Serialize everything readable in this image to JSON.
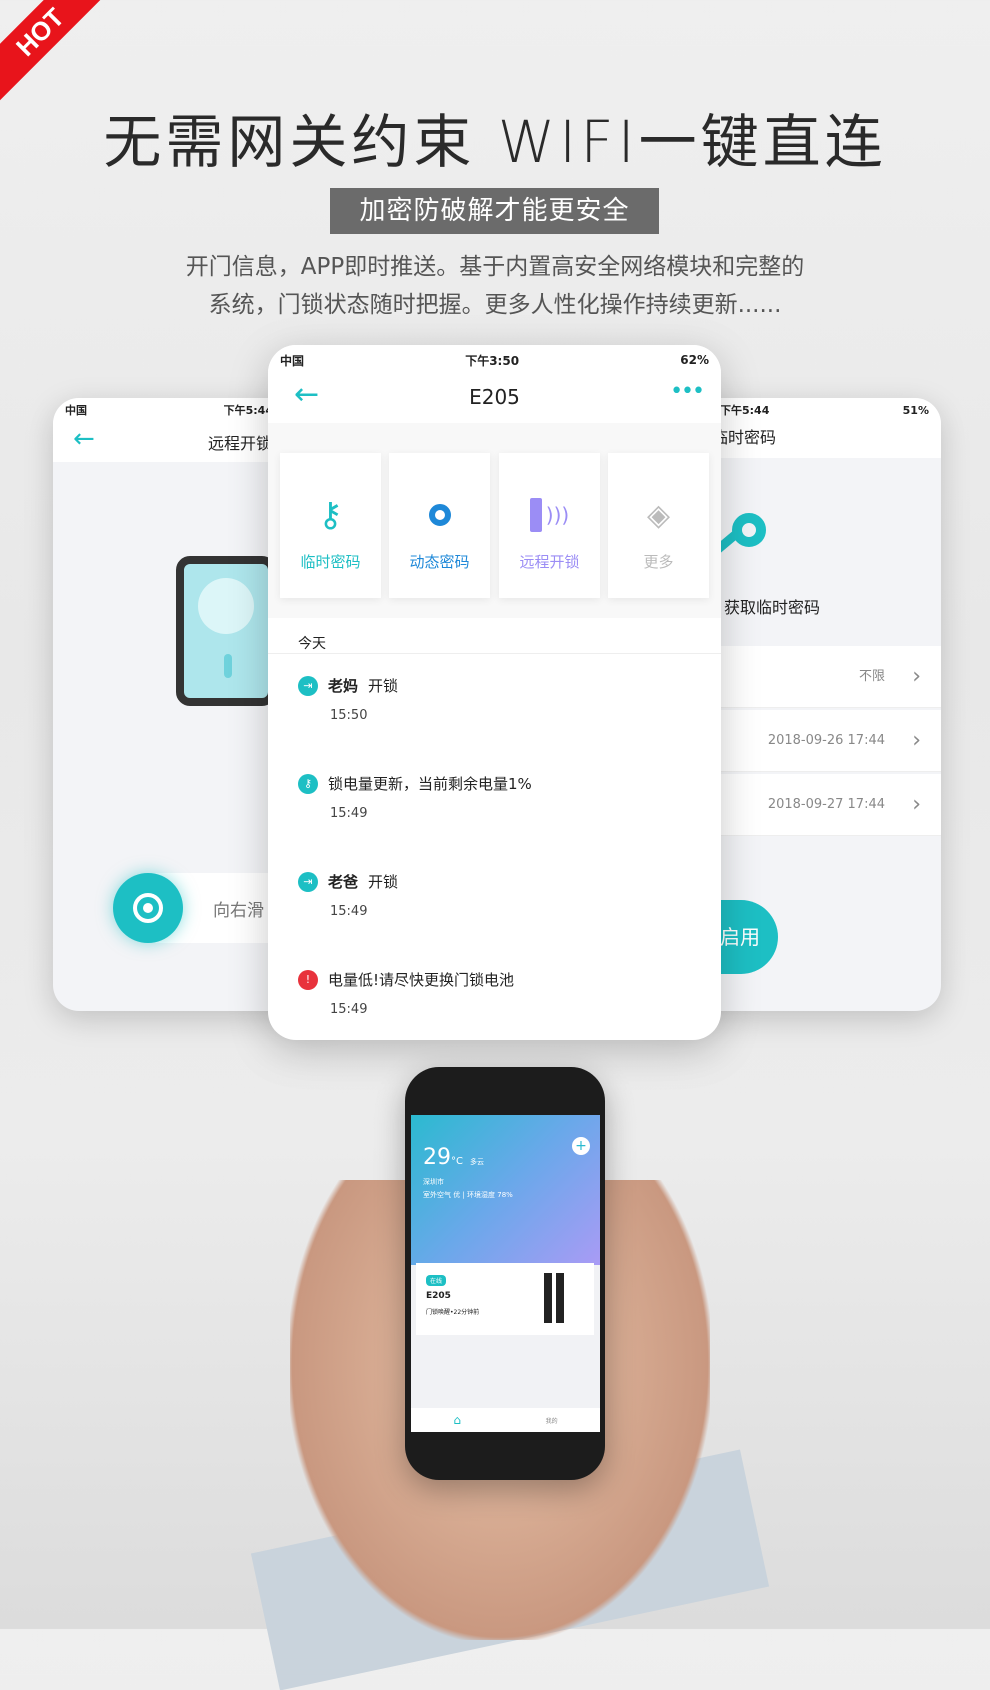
{
  "badge": "HOT",
  "headline": "无需网关约束 WIFI一键直连",
  "subheadline": "加密防破解才能更安全",
  "description": [
    "开门信息，APP即时推送。基于内置高安全网络模块和完整的",
    "系统，门锁状态随时把握。更多人性化操作持续更新......"
  ],
  "left_screen": {
    "carrier": "中国",
    "time": "下午5:44",
    "title": "远程开锁",
    "slide_hint": "向右滑"
  },
  "center_screen": {
    "carrier": "中国",
    "time": "下午3:50",
    "battery": "62%",
    "title": "E205",
    "tiles": [
      {
        "label": "临时密码",
        "color": "#1dbfc4",
        "icon": "key-icon"
      },
      {
        "label": "动态密码",
        "color": "#1e88d8",
        "icon": "dynamic-key-icon"
      },
      {
        "label": "远程开锁",
        "color": "#9b8df5",
        "icon": "remote-unlock-icon"
      },
      {
        "label": "更多",
        "color": "#bbbbbb",
        "icon": "layers-icon"
      }
    ],
    "section": "今天",
    "events": [
      {
        "who": "老妈",
        "action": "开锁",
        "time": "15:50",
        "type": "unlock"
      },
      {
        "who": "",
        "action": "锁电量更新，当前剩余电量1%",
        "time": "15:49",
        "type": "battery"
      },
      {
        "who": "老爸",
        "action": "开锁",
        "time": "15:49",
        "type": "unlock"
      },
      {
        "who": "",
        "action": "电量低!请尽快更换门锁电池",
        "time": "15:49",
        "type": "warning"
      }
    ]
  },
  "right_screen": {
    "time": "下午5:44",
    "battery": "51%",
    "title": "临时密码",
    "caption": "获取临时密码",
    "rows": [
      "不限",
      "2018-09-26 17:44",
      "2018-09-27 17:44"
    ],
    "button": "启用"
  },
  "hand_phone": {
    "temp": "29",
    "unit": "°C",
    "weather": "多云",
    "city": "深圳市",
    "air": "室外空气 优 | 环境湿度 78%",
    "status_tag": "在线",
    "device": "E205",
    "device_status": "门锁唤醒•22分钟前",
    "nav_profile": "我的"
  },
  "colors": {
    "accent": "#1dbfc4",
    "warning": "#e8323c",
    "badge": "#e8141b"
  }
}
